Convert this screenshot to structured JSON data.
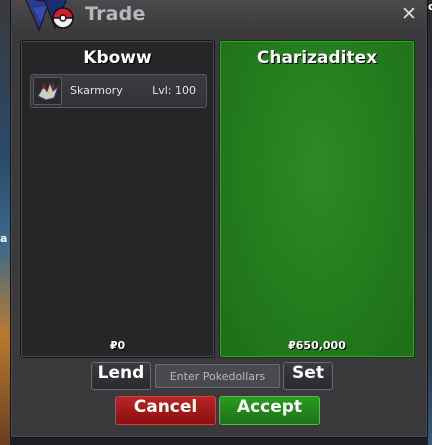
{
  "window": {
    "title": "Trade",
    "close_symbol": "✕"
  },
  "background": {
    "left_edge_text": "a",
    "right_edge_text": "c"
  },
  "left_panel": {
    "player_name": "Kboww",
    "money": "₽0",
    "pokemon": [
      {
        "name": "Skarmory",
        "level": "Lvl: 100",
        "icon": "skarmory-sprite-icon"
      }
    ]
  },
  "right_panel": {
    "player_name": "Charizaditex",
    "money": "₽650,000",
    "highlight_color": "#27801f"
  },
  "controls": {
    "lend_label": "Lend",
    "money_placeholder": "Enter Pokedollars",
    "set_label": "Set",
    "cancel_label": "Cancel",
    "accept_label": "Accept"
  },
  "colors": {
    "cancel": "#a01a1a",
    "accept": "#248a1c",
    "panel_dark": "#262629"
  }
}
